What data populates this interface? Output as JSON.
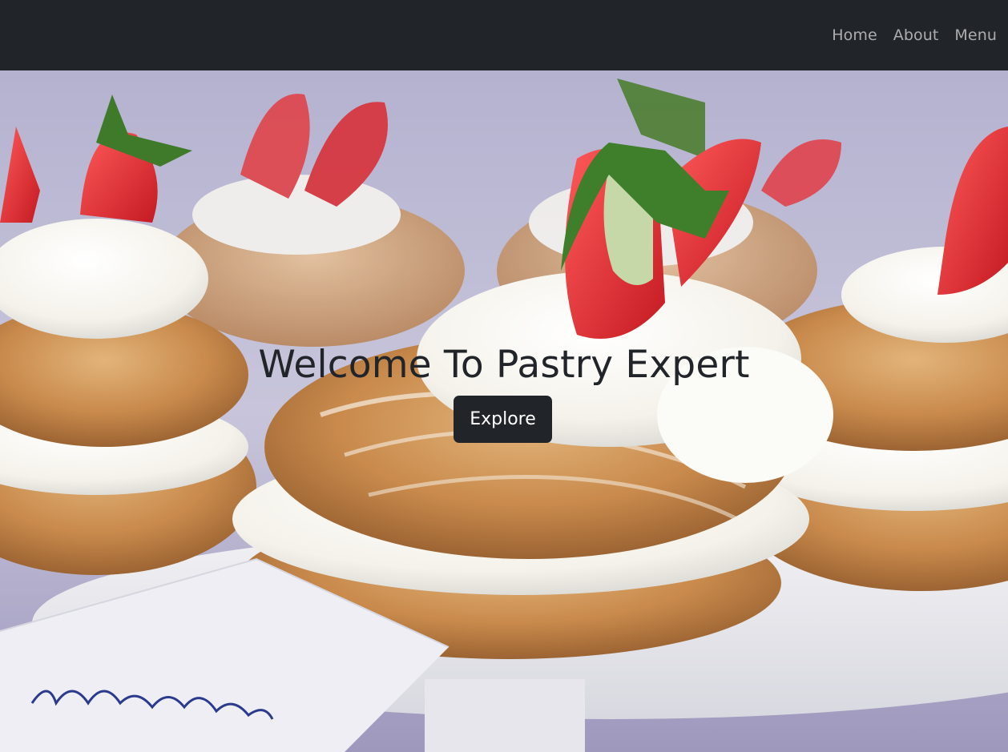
{
  "navbar": {
    "links": [
      {
        "label": "Home"
      },
      {
        "label": "About"
      },
      {
        "label": "Menu"
      }
    ],
    "background": "#212529"
  },
  "hero": {
    "image": "cream-puffs-with-strawberries-photo",
    "title": "Welcome To Pastry Expert",
    "cta_label": "Explore",
    "colors": {
      "title": "#212529",
      "button_bg": "#212529",
      "button_text": "#ffffff"
    }
  }
}
